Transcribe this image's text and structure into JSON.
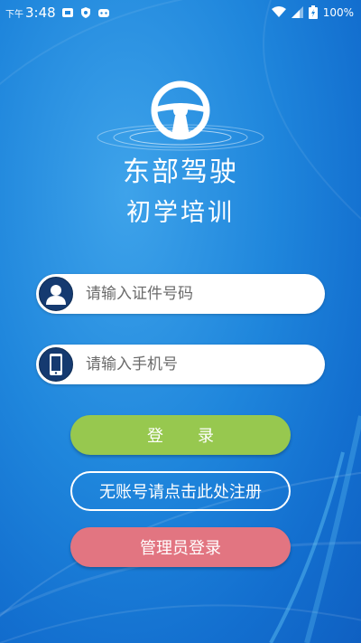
{
  "status_bar": {
    "time_prefix": "下午",
    "time": "3:48",
    "battery": "100%"
  },
  "app": {
    "title_line1": "东部驾驶",
    "title_line2": "初学培训"
  },
  "form": {
    "id_placeholder": "请输入证件号码",
    "phone_placeholder": "请输入手机号"
  },
  "buttons": {
    "login_label": "登录",
    "register_label": "无账号请点击此处注册",
    "admin_label": "管理员登录"
  },
  "colors": {
    "background": "#1f86dc",
    "login_button": "#97c84f",
    "admin_button": "#e27581",
    "icon_circle": "#153a70"
  }
}
